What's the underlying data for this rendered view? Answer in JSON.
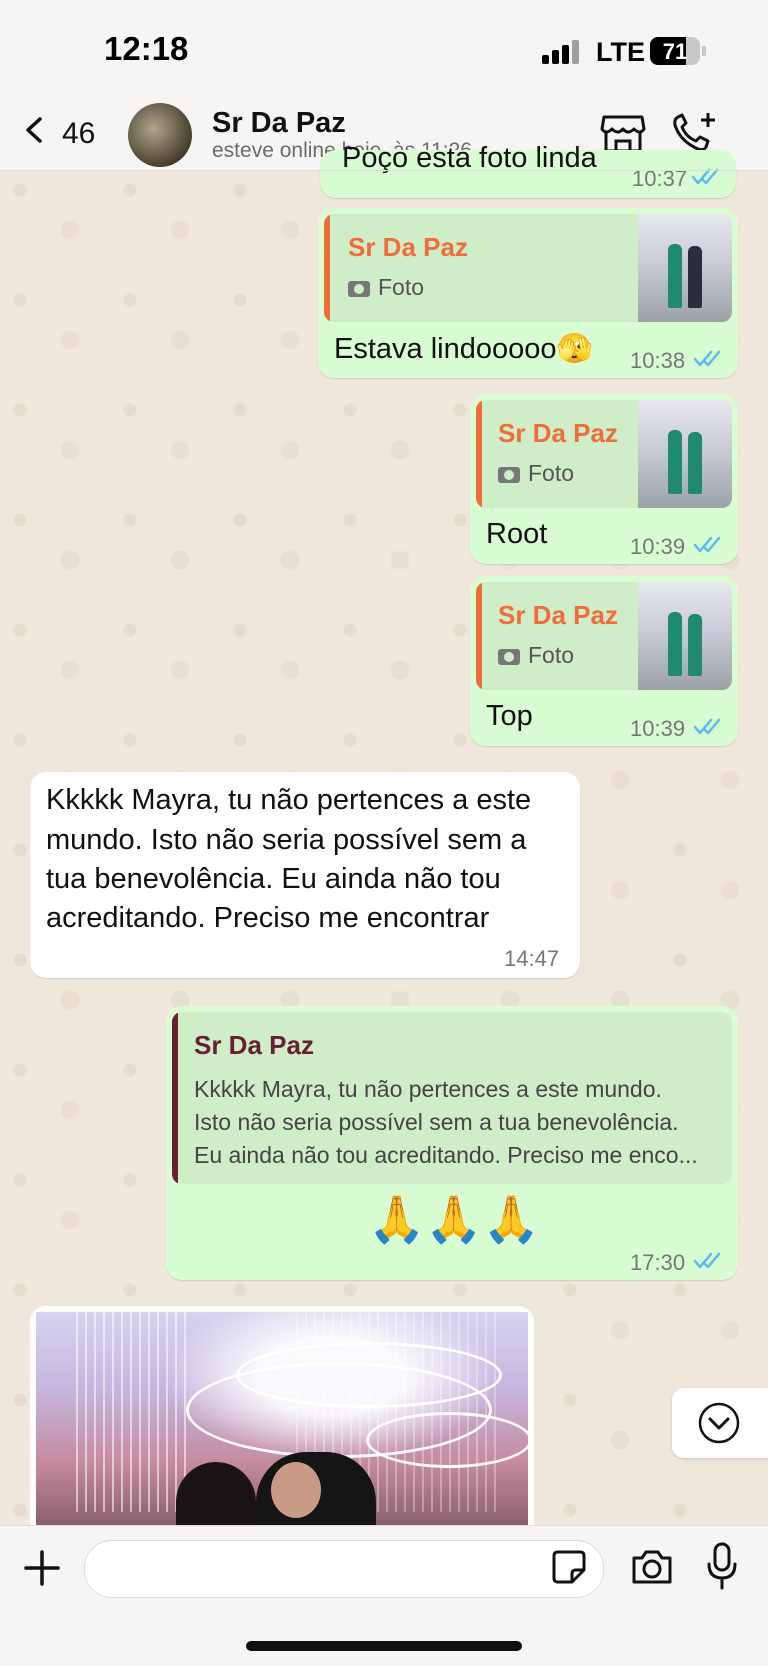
{
  "status_bar": {
    "time": "12:18",
    "network": "LTE",
    "battery": "71",
    "battery_level": 0.71
  },
  "header": {
    "back_count": "46",
    "contact_name": "Sr Da Paz",
    "contact_status": "esteve online hoje, às 11:26",
    "icons": [
      "chevron-left-icon",
      "shop-icon",
      "call-add-icon"
    ]
  },
  "messages": [
    {
      "id": "m0",
      "direction": "out",
      "text": "Poço esta foto linda",
      "time": "10:37",
      "read": true
    },
    {
      "id": "m1",
      "direction": "out",
      "quote_name": "Sr Da Paz",
      "quote_type": "Foto",
      "text": "Estava lindooooo🫣",
      "time": "10:38",
      "read": true
    },
    {
      "id": "m2",
      "direction": "out",
      "quote_name": "Sr Da Paz",
      "quote_type": "Foto",
      "text": "Root",
      "time": "10:39",
      "read": true
    },
    {
      "id": "m3",
      "direction": "out",
      "quote_name": "Sr Da Paz",
      "quote_type": "Foto",
      "text": "Top",
      "time": "10:39",
      "read": true
    },
    {
      "id": "m4",
      "direction": "in",
      "text_lines": [
        "Kkkkk Mayra, tu não pertences a este",
        "mundo. Isto não seria possível sem a",
        "tua benevolência. Eu ainda não tou",
        "acreditando. Preciso me encontrar"
      ],
      "time": "14:47"
    },
    {
      "id": "m5",
      "direction": "out",
      "quote_name": "Sr Da Paz",
      "quote_lines": [
        "Kkkkk Mayra, tu não pertences a este mundo.",
        "Isto não seria possível sem a tua benevolência.",
        "Eu ainda não tou acreditando. Preciso me enco..."
      ],
      "text": "🙏🙏🙏",
      "time": "17:30",
      "read": true
    }
  ],
  "colors": {
    "quote_orange": "#f26b3a",
    "quote_maroon": "#6b1d34",
    "tick_blue": "#53bdeb",
    "bubble_out": "#d9fdd3"
  },
  "input": {
    "placeholder": "",
    "icons": [
      "plus-icon",
      "sticker-icon",
      "camera-icon",
      "mic-icon"
    ]
  }
}
